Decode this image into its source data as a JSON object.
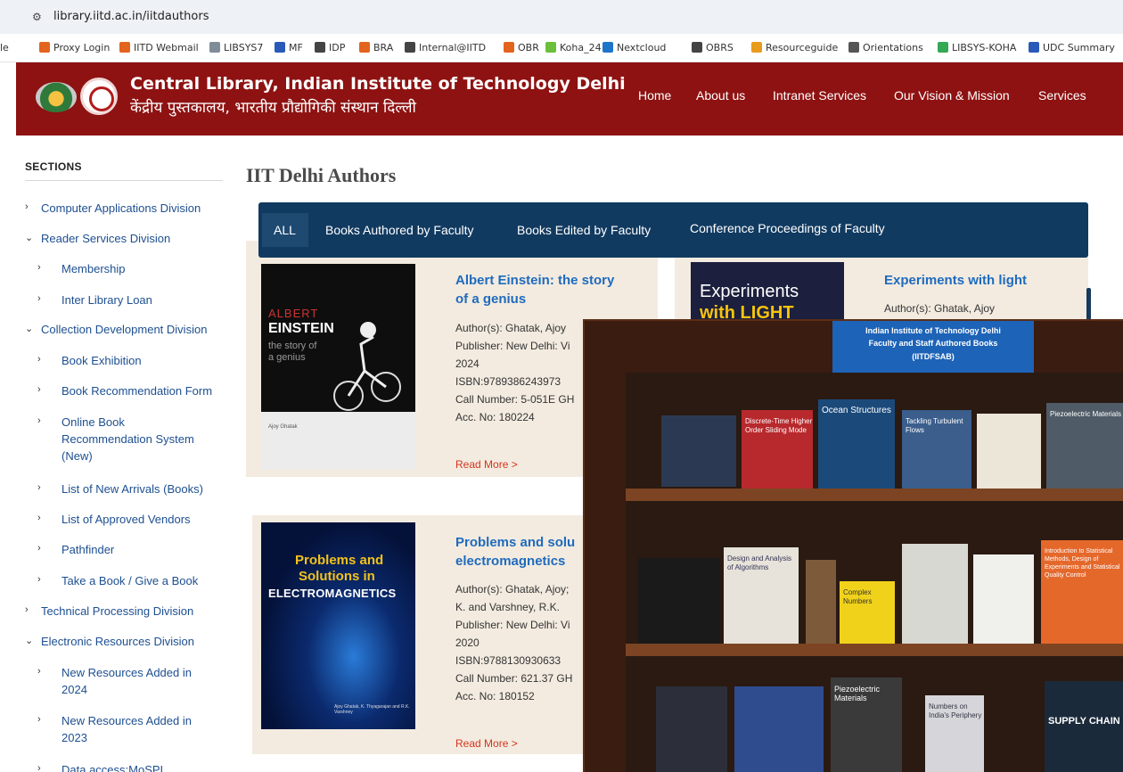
{
  "browser": {
    "url": "library.iitd.ac.in/iitdauthors",
    "bookmarks": [
      {
        "label": "le",
        "color": "#ffffff"
      },
      {
        "label": "Proxy Login",
        "color": "#e2641d"
      },
      {
        "label": "IITD Webmail",
        "color": "#e2641d"
      },
      {
        "label": "LIBSYS7",
        "color": "#7f8c98"
      },
      {
        "label": "MF",
        "color": "#2a5ab8"
      },
      {
        "label": "IDP",
        "color": "#444444"
      },
      {
        "label": "BRA",
        "color": "#e2641d"
      },
      {
        "label": "Internal@IITD",
        "color": "#444444"
      },
      {
        "label": "OBR",
        "color": "#e2641d"
      },
      {
        "label": "Koha_24",
        "color": "#6bbf3b"
      },
      {
        "label": "Nextcloud",
        "color": "#1d74c9"
      },
      {
        "label": "OBRS",
        "color": "#444444"
      },
      {
        "label": "Resourceguide",
        "color": "#e89b1d"
      },
      {
        "label": "Orientations",
        "color": "#555555"
      },
      {
        "label": "LIBSYS-KOHA",
        "color": "#34a853"
      },
      {
        "label": "UDC Summary",
        "color": "#2a5ab8"
      }
    ]
  },
  "header": {
    "title": "Central Library, Indian Institute of Technology Delhi",
    "title_hindi": "केंद्रीय पुस्तकालय, भारतीय प्रौद्योगिकी संस्थान दिल्ली",
    "background": "#8e1212",
    "nav": [
      "Home",
      "About us",
      "Intranet Services",
      "Our Vision & Mission",
      "Services"
    ]
  },
  "sidebar": {
    "heading": "SECTIONS",
    "items": [
      {
        "label": "Computer Applications Division",
        "arrow": "›"
      },
      {
        "label": "Reader Services Division",
        "arrow": "⌄"
      },
      {
        "label": "Membership",
        "arrow": "›"
      },
      {
        "label": "Inter Library Loan",
        "arrow": "›"
      },
      {
        "label": "Collection Development Division",
        "arrow": "⌄"
      },
      {
        "label": "Book Exhibition",
        "arrow": "›"
      },
      {
        "label": "Book Recommendation Form",
        "arrow": "›"
      },
      {
        "label": "Online Book Recommendation System (New)",
        "arrow": "›"
      },
      {
        "label": "List of New Arrivals (Books)",
        "arrow": "›"
      },
      {
        "label": "List of Approved Vendors",
        "arrow": "›"
      },
      {
        "label": "Pathfinder",
        "arrow": "›"
      },
      {
        "label": "Take a Book / Give a Book",
        "arrow": "›"
      },
      {
        "label": "Technical Processing Division",
        "arrow": "›"
      },
      {
        "label": "Electronic Resources Division",
        "arrow": "⌄"
      },
      {
        "label": "New Resources Added in 2024",
        "arrow": "›"
      },
      {
        "label": "New Resources Added in 2023",
        "arrow": "›"
      },
      {
        "label": "Data access:MoSPI",
        "arrow": "›"
      }
    ]
  },
  "main": {
    "title": "IIT Delhi Authors",
    "tabs": [
      "ALL",
      "Books Authored by Faculty",
      "Books Edited by Faculty",
      "Conference Proceedings of Faculty"
    ],
    "tab_bar_color": "#113a60",
    "books": [
      {
        "title_line1": "Albert Einstein: the story",
        "title_line2": "of a genius",
        "authors": "Author(s): Ghatak, Ajoy",
        "publisher": "Publisher: New Delhi: Vi",
        "year": "2024",
        "isbn": "ISBN:9789386243973",
        "call_number": "Call Number: 5-051E GH",
        "acc_no": "Acc. No: 180224",
        "read_more": "Read More >",
        "cover": {
          "top": "ALBERT",
          "main": "EINSTEIN",
          "sub": "the story of a genius",
          "author": "Ajoy Ghatak"
        }
      },
      {
        "title_line1": "Problems and solu",
        "title_line2": "electromagnetics",
        "authors": "Author(s): Ghatak, Ajoy;",
        "authors_line2": "K. and Varshney, R.K.",
        "publisher": "Publisher: New Delhi: Vi",
        "year": "2020",
        "isbn": "ISBN:9788130930633",
        "call_number": "Call Number: 621.37 GH",
        "acc_no": "Acc. No: 180152",
        "read_more": "Read More >",
        "cover": {
          "p1": "Problems and",
          "p2": "Solutions in",
          "p3": "ELECTROMAGNETICS",
          "authors": "Ajoy Ghatak, K. Thyagarajan and R.K. Varshney"
        }
      },
      {
        "title": "Experiments with light",
        "authors": "Author(s): Ghatak, Ajoy",
        "cover": {
          "t1": "Experiments",
          "t2": "with LIGHT"
        }
      }
    ]
  },
  "photo": {
    "sign_line1": "Indian Institute of Technology Delhi",
    "sign_line2": "Faculty and Staff Authored Books",
    "sign_line3": "(IITDFSAB)",
    "spines": [
      "Discrete-Time Higher Order Sliding Mode",
      "Ocean Structures",
      "Tackling Turbulent Flows",
      "Piezoelectric Materials",
      "Design and Analysis of Algorithms",
      "Complex Numbers",
      "Introduction to Statistical Methods, Design of Experiments and Statistical Quality Control",
      "Piezoelectric Materials",
      "Numbers on India's Periphery",
      "SUPPLY CHAIN"
    ]
  }
}
